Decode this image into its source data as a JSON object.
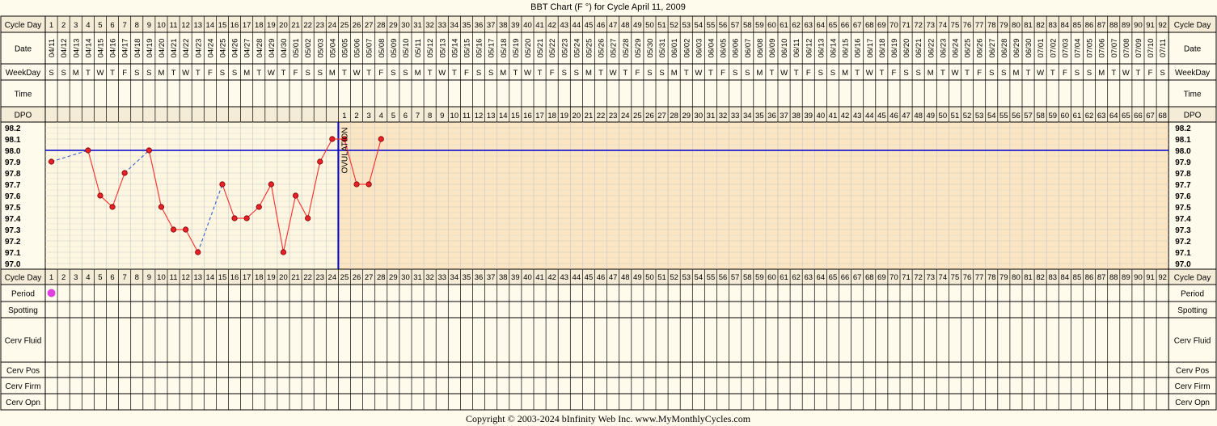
{
  "title": "BBT Chart (F °) for Cycle April 11, 2009",
  "footer": "Copyright © 2003-2024 bInfinity Web Inc.    www.MyMonthlyCycles.com",
  "row_labels": {
    "cycle_day": "Cycle Day",
    "date": "Date",
    "weekday": "WeekDay",
    "time": "Time",
    "dpo": "DPO",
    "period": "Period",
    "spotting": "Spotting",
    "cerv_fluid": "Cerv Fluid",
    "cerv_pos": "Cerv Pos",
    "cerv_firm": "Cerv Firm",
    "cerv_opn": "Cerv Opn"
  },
  "ovulation_label": "OVULATION",
  "colors": {
    "background": "#fffbec",
    "pre_ovulation_fill": "#fdf7e1",
    "post_ovulation_fill": "#fbe5c2",
    "header_fill": "#f4ecd6",
    "grid": "#c8c8c8",
    "temperature_line": "#ff2a2a",
    "marker_fill": "#e8202a",
    "coverline": "#0000cc",
    "ovulation_line": "#0000cc",
    "period_marker": "#e040e0"
  },
  "chart_data": {
    "type": "line",
    "x_label": "Cycle Day",
    "days": [
      1,
      2,
      3,
      4,
      5,
      6,
      7,
      8,
      9,
      10,
      11,
      12,
      13,
      14,
      15,
      16,
      17,
      18,
      19,
      20,
      21,
      22,
      23,
      24,
      25,
      26,
      27,
      28,
      29,
      30,
      31,
      32,
      33,
      34,
      35,
      36,
      37,
      38,
      39,
      40,
      41,
      42,
      43,
      44,
      45,
      46,
      47,
      48,
      49,
      50,
      51,
      52,
      53,
      54,
      55,
      56,
      57,
      58,
      59,
      60,
      61,
      62,
      63,
      64,
      65,
      66,
      67,
      68,
      69,
      70,
      71,
      72,
      73,
      74,
      75,
      76,
      77,
      78,
      79,
      80,
      81,
      82,
      83,
      84,
      85,
      86,
      87,
      88,
      89,
      90,
      91,
      92
    ],
    "dates": [
      "04/11",
      "04/12",
      "04/13",
      "04/14",
      "04/15",
      "04/16",
      "04/17",
      "04/18",
      "04/19",
      "04/20",
      "04/21",
      "04/22",
      "04/23",
      "04/24",
      "04/25",
      "04/26",
      "04/27",
      "04/28",
      "04/29",
      "04/30",
      "05/01",
      "05/02",
      "05/03",
      "05/04",
      "05/05",
      "05/06",
      "05/07",
      "05/08",
      "05/09",
      "05/10",
      "05/11",
      "05/12",
      "05/13",
      "05/14",
      "05/15",
      "05/16",
      "05/17",
      "05/18",
      "05/19",
      "05/20",
      "05/21",
      "05/22",
      "05/23",
      "05/24",
      "05/25",
      "05/26",
      "05/27",
      "05/28",
      "05/29",
      "05/30",
      "05/31",
      "06/01",
      "06/02",
      "06/03",
      "06/04",
      "06/05",
      "06/06",
      "06/07",
      "06/08",
      "06/09",
      "06/10",
      "06/11",
      "06/12",
      "06/13",
      "06/14",
      "06/15",
      "06/16",
      "06/17",
      "06/18",
      "06/19",
      "06/20",
      "06/21",
      "06/22",
      "06/23",
      "06/24",
      "06/25",
      "06/26",
      "06/27",
      "06/28",
      "06/29",
      "06/30",
      "07/01",
      "07/02",
      "07/03",
      "07/04",
      "07/05",
      "07/06",
      "07/07",
      "07/08",
      "07/09",
      "07/10",
      "07/11"
    ],
    "weekdays": [
      "S",
      "S",
      "M",
      "T",
      "W",
      "T",
      "F",
      "S",
      "S",
      "M",
      "T",
      "W",
      "T",
      "F",
      "S",
      "S",
      "M",
      "T",
      "W",
      "T",
      "F",
      "S",
      "S",
      "M",
      "T",
      "W",
      "T",
      "F",
      "S",
      "S",
      "M",
      "T",
      "W",
      "T",
      "F",
      "S",
      "S",
      "M",
      "T",
      "W",
      "T",
      "F",
      "S",
      "S",
      "M",
      "T",
      "W",
      "T",
      "F",
      "S",
      "S",
      "M",
      "T",
      "W",
      "T",
      "F",
      "S",
      "S",
      "M",
      "T",
      "W",
      "T",
      "F",
      "S",
      "S",
      "M",
      "T",
      "W",
      "T",
      "F",
      "S",
      "S",
      "M",
      "T",
      "W",
      "T",
      "F",
      "S",
      "S",
      "M",
      "T",
      "W",
      "T",
      "F",
      "S",
      "S",
      "M",
      "T",
      "W",
      "T",
      "F",
      "S"
    ],
    "dpo_start_day": 25,
    "dpo_count": 68,
    "temperatures": [
      {
        "day": 1,
        "temp": 97.9
      },
      {
        "day": 4,
        "temp": 98.0
      },
      {
        "day": 5,
        "temp": 97.6
      },
      {
        "day": 6,
        "temp": 97.5
      },
      {
        "day": 7,
        "temp": 97.8
      },
      {
        "day": 9,
        "temp": 98.0
      },
      {
        "day": 10,
        "temp": 97.5
      },
      {
        "day": 11,
        "temp": 97.3
      },
      {
        "day": 12,
        "temp": 97.3
      },
      {
        "day": 13,
        "temp": 97.1
      },
      {
        "day": 15,
        "temp": 97.7
      },
      {
        "day": 16,
        "temp": 97.4
      },
      {
        "day": 17,
        "temp": 97.4
      },
      {
        "day": 18,
        "temp": 97.5
      },
      {
        "day": 19,
        "temp": 97.7
      },
      {
        "day": 20,
        "temp": 97.1
      },
      {
        "day": 21,
        "temp": 97.6
      },
      {
        "day": 22,
        "temp": 97.4
      },
      {
        "day": 23,
        "temp": 97.9
      },
      {
        "day": 24,
        "temp": 98.1
      },
      {
        "day": 25,
        "temp": 98.1
      },
      {
        "day": 26,
        "temp": 97.7
      },
      {
        "day": 27,
        "temp": 97.7
      },
      {
        "day": 28,
        "temp": 98.1
      }
    ],
    "gap_segments": [
      [
        1,
        4
      ],
      [
        9,
        10
      ],
      [
        13,
        15
      ]
    ],
    "coverline": 98.0,
    "ovulation_day": 24,
    "y_ticks": [
      98.2,
      98.1,
      98.0,
      97.9,
      97.8,
      97.7,
      97.6,
      97.5,
      97.4,
      97.3,
      97.2,
      97.1,
      97.0
    ],
    "ylim": [
      97.0,
      98.2
    ],
    "period_days": [
      1
    ],
    "grid": true
  }
}
